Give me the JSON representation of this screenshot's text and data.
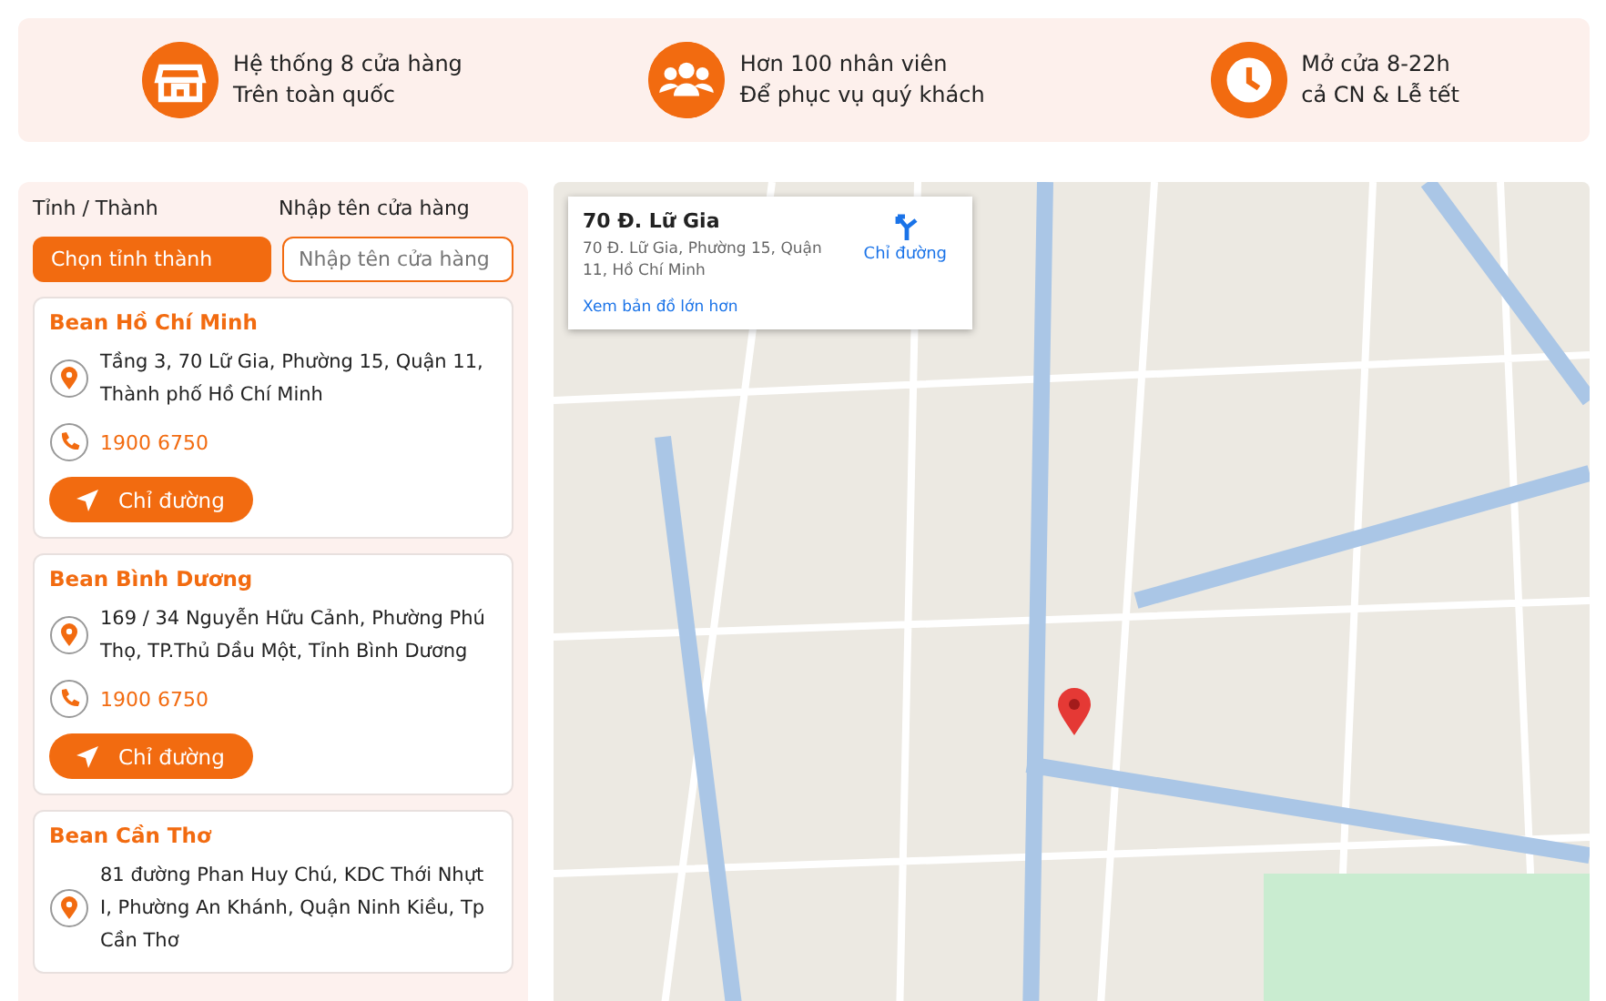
{
  "features": [
    {
      "kind": "store",
      "line1": "Hệ thống 8 cửa hàng",
      "line2": "Trên toàn quốc"
    },
    {
      "kind": "people",
      "line1": "Hơn 100 nhân viên",
      "line2": "Để phục vụ quý khách"
    },
    {
      "kind": "clock",
      "line1": "Mở cửa 8-22h",
      "line2": "cả CN & Lễ tết"
    }
  ],
  "filters": {
    "province_label": "Tỉnh / Thành",
    "province_button": "Chọn tỉnh thành",
    "name_label": "Nhập tên cửa hàng",
    "name_placeholder": "Nhập tên cửa hàng"
  },
  "stores": [
    {
      "name": "Bean Hồ Chí Minh",
      "address": "Tầng 3, 70 Lữ Gia, Phường 15, Quận 11, Thành phố Hồ Chí Minh",
      "phone": "1900 6750",
      "button": "Chỉ đường"
    },
    {
      "name": "Bean Bình Dương",
      "address": "169 / 34 Nguyễn Hữu Cảnh, Phường Phú Thọ, TP.Thủ Dầu Một, Tỉnh Bình Dương",
      "phone": "1900 6750",
      "button": "Chỉ đường"
    },
    {
      "name": "Bean Cần Thơ",
      "address": "81 đường Phan Huy Chú, KDC Thới Nhựt I, Phường An Khánh, Quận Ninh Kiều, Tp Cần Thơ"
    }
  ],
  "map": {
    "place_title": "70 Đ. Lữ Gia",
    "place_address": "70 Đ. Lữ Gia, Phường 15, Quận 11, Hồ Chí Minh",
    "directions": "Chỉ đường",
    "larger_map": "Xem bản đồ lớn hơn"
  }
}
